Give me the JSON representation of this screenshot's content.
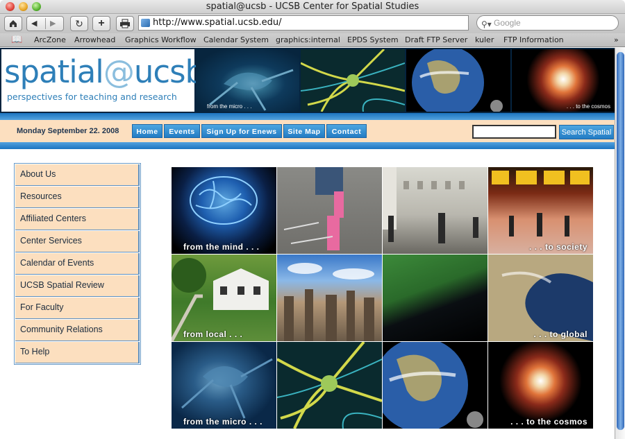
{
  "window": {
    "title": "spatial@ucsb - UCSB Center for Spatial Studies"
  },
  "browser": {
    "url": "http://www.spatial.ucsb.edu/",
    "search_placeholder": "Google",
    "bookmarks": [
      "ArcZone",
      "Arrowhead",
      "Graphics Workflow",
      "Calendar System",
      "graphics:internal",
      "EPDS System",
      "Draft FTP Server",
      "kuler",
      "FTP Information"
    ]
  },
  "site": {
    "logo_text_1": "spatial",
    "logo_text_at": "@",
    "logo_text_2": "ucsb",
    "tagline": "perspectives for teaching and research",
    "header_labels": {
      "micro": "from the micro . . .",
      "cosmos": ". . . to the cosmos"
    },
    "date": "Monday September 22. 2008",
    "nav": [
      "Home",
      "Events",
      "Sign Up for Enews",
      "Site Map",
      "Contact"
    ],
    "search_button": "Search Spatial",
    "sidebar": [
      "About Us",
      "Resources",
      "Affiliated Centers",
      "Center Services",
      "Calendar of Events",
      "UCSB Spatial Review",
      "For Faculty",
      "Community Relations",
      "To Help"
    ],
    "grid_captions": {
      "mind": "from the mind . . .",
      "society": ". . . to society",
      "local": "from local . . .",
      "global": ". . . to global",
      "micro": "from the micro . . .",
      "cosmos": ". . . to the cosmos"
    }
  },
  "colors": {
    "accent": "#2e7fb8",
    "nav_button": "#2f8bd0",
    "sidebar_bg": "#fcdfbf",
    "header_bg": "#06243f"
  }
}
